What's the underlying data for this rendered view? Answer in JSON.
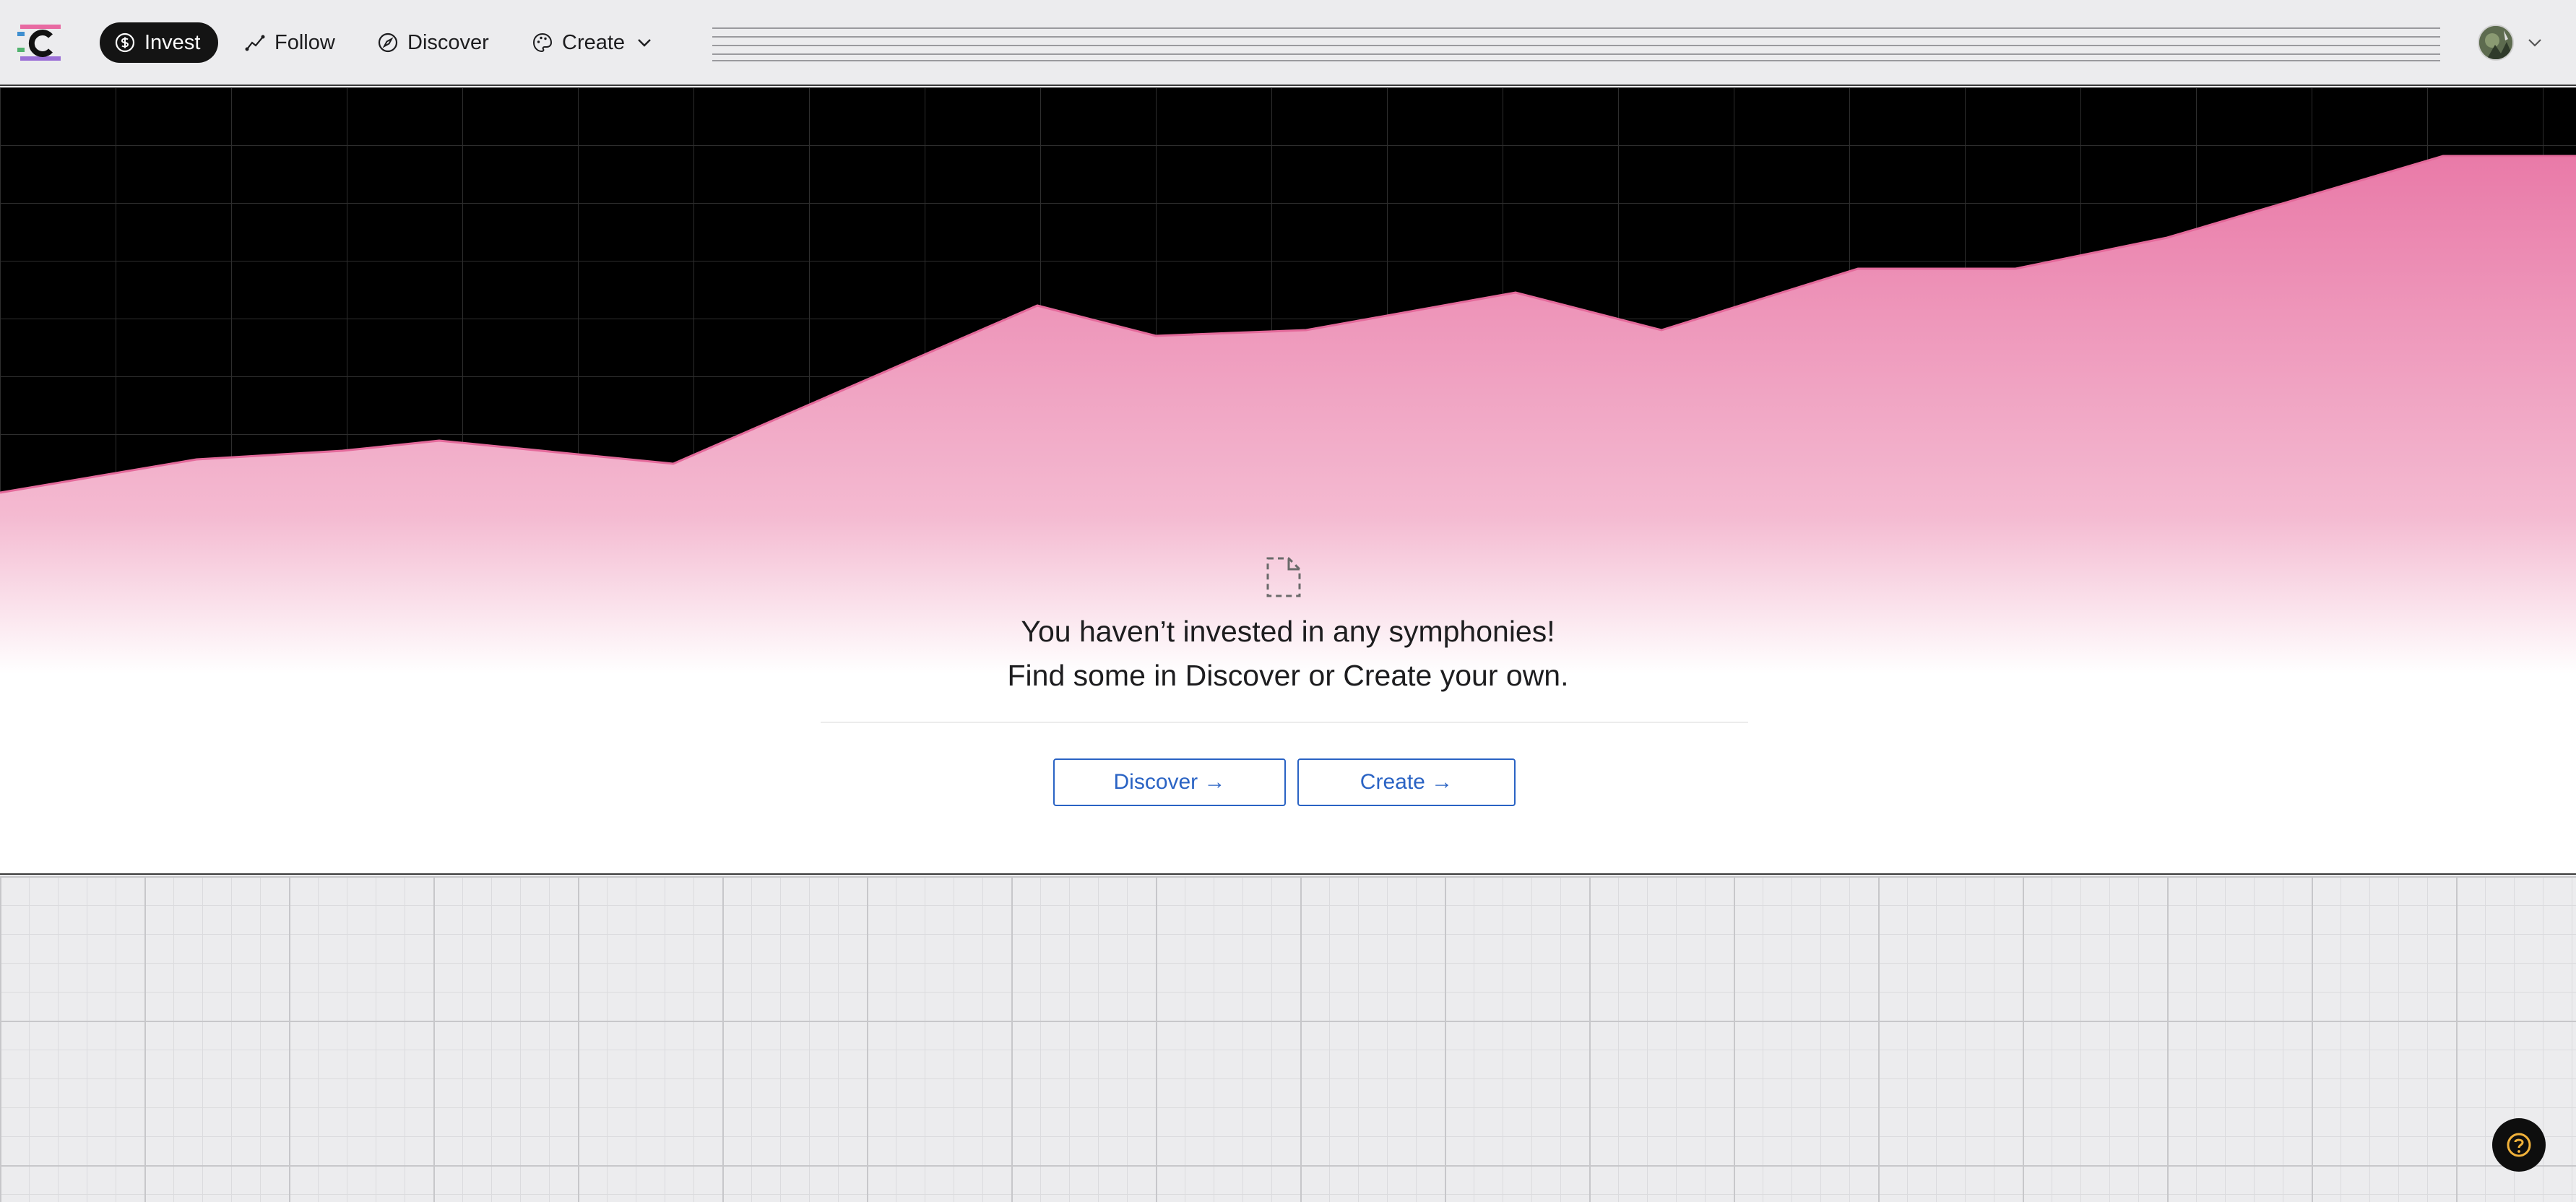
{
  "nav": {
    "invest_label": "Invest",
    "follow_label": "Follow",
    "discover_label": "Discover",
    "create_label": "Create",
    "active": "Invest"
  },
  "icons": {
    "logo": "composer-logo-icon",
    "invest": "dollar-circle-icon",
    "follow": "trend-line-icon",
    "discover": "compass-icon",
    "create": "palette-icon",
    "create_menu": "chevron-down-icon",
    "account_menu": "chevron-down-icon",
    "empty_state": "dashed-file-icon",
    "help": "question-circle-icon"
  },
  "hero": {
    "message_line1": "You haven’t invested in any symphonies!",
    "message_line2": "Find some in Discover or Create your own.",
    "discover_button": "Discover →",
    "create_button": "Create →"
  },
  "colors": {
    "accent_pink": "#e97aa8",
    "link_blue": "#2a63c4",
    "help_ring": "#f2b23a",
    "nav_active_bg": "#141414"
  }
}
